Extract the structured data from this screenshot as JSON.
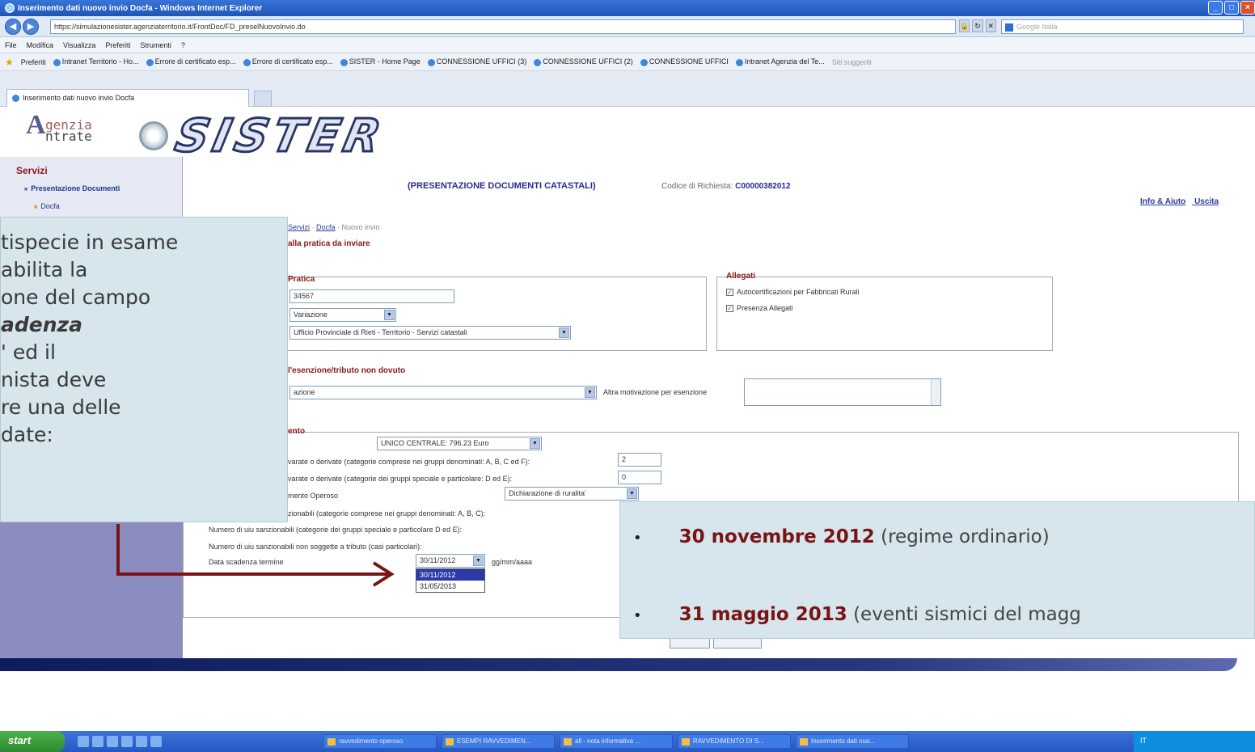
{
  "window": {
    "title": "Inserimento dati nuovo invio Docfa - Windows Internet Explorer"
  },
  "address": {
    "url": "https://simulazionesister.agenziaterritorio.it/FrontDoc/FD_preselNuovoInvio.do",
    "search_placeholder": "Google Italia"
  },
  "menu": [
    "File",
    "Modifica",
    "Visualizza",
    "Preferiti",
    "Strumenti",
    "?"
  ],
  "favorites": {
    "label": "Preferiti",
    "items": [
      "Intranet Territorio - Ho...",
      "Errore di certificato esp...",
      "Errore di certificato esp...",
      "SISTER - Home Page",
      "CONNESSIONE UFFICI (3)",
      "CONNESSIONE UFFICI (2)",
      "CONNESSIONE UFFICI",
      "Intranet Agenzia del Te...",
      "Siti suggeriti"
    ]
  },
  "tab": {
    "title": "Inserimento dati nuovo invio Docfa"
  },
  "header": {
    "agenzia_line1": "genzia",
    "agenzia_line2": "ntrate",
    "agenzia_initial": "A",
    "logo_text": "SISTER"
  },
  "sidebar": {
    "title": "Servizi",
    "items": [
      "Presentazione Documenti",
      "Docfa"
    ]
  },
  "page": {
    "title": "(PRESENTAZIONE DOCUMENTI CATASTALI)",
    "request_label": "Codice di Richiesta:",
    "request_code": "C00000382012",
    "info_link": "Info & Aiuto",
    "exit_link": "Uscita",
    "breadcrumb": [
      "Servizi",
      "Docfa",
      "Nuovo invio"
    ],
    "section_main": "alla pratica da inviare"
  },
  "pratica": {
    "heading": "Pratica",
    "number": "34567",
    "type": "Variazione",
    "office": "Ufficio Provinciale di Rieti - Territorio - Servizi catastali"
  },
  "allegati": {
    "heading": "Allegati",
    "items": [
      "Autocertificazioni per Fabbricati Rurali",
      "Presenza Allegati"
    ]
  },
  "esenzione": {
    "heading": "l'esenzione/tributo non dovuto",
    "select": "azione",
    "other_label": "Altra motivazione per esenzione"
  },
  "pagamento": {
    "heading": "ento",
    "amount": "UNICO CENTRALE: 796.23 Euro",
    "row1_label": "varate o derivate (categorie comprese nei gruppi denominati: A, B, C ed F):",
    "row1_value": "2",
    "row2_label": "varate o derivate (categorie dei gruppi speciale e particolare: D ed E):",
    "row2_value": "0",
    "row3_label": "mento Operoso",
    "row3_value": "Dichiarazione di ruralita'",
    "row4_label": "zionabili (categorie comprese nei gruppi denominati: A, B, C):",
    "row5_label": "Numero di uiu sanzionabili (categorie dei gruppi speciale e particolare D ed E):",
    "row6_label": "Numero di uiu sanzionabili non soggette a tributo (casi particolari):",
    "deadline_label": "Data scadenza termine",
    "deadline_value": "30/11/2012",
    "deadline_format": "gg/mm/aaaa",
    "deadline_options": [
      "30/11/2012",
      "31/05/2013"
    ]
  },
  "callout": {
    "lines": [
      "tispecie in esame",
      " abilita la",
      "one del campo",
      "adenza",
      "' ed il",
      "nista deve",
      "re una delle",
      "date:"
    ]
  },
  "dates": {
    "items": [
      {
        "date": "30 novembre 2012",
        "note": "(regime ordinario)"
      },
      {
        "date": "31 maggio 2013",
        "note": "(eventi sismici del magg"
      }
    ]
  },
  "taskbar": {
    "start": "start",
    "tasks": [
      "ravvedimento operoso",
      "ESEMPI RAVVEDIMEN...",
      "all - nota informativa ...",
      "RAVVEDIMENTO DI S...",
      "Inserimento dati nuo..."
    ],
    "tray": "IT"
  },
  "colors": {
    "accent_dark_red": "#7a1414",
    "sidebar_purple": "#8b8dc0",
    "callout_bg": "#d6e6ec",
    "arrow": "#7a1414"
  }
}
